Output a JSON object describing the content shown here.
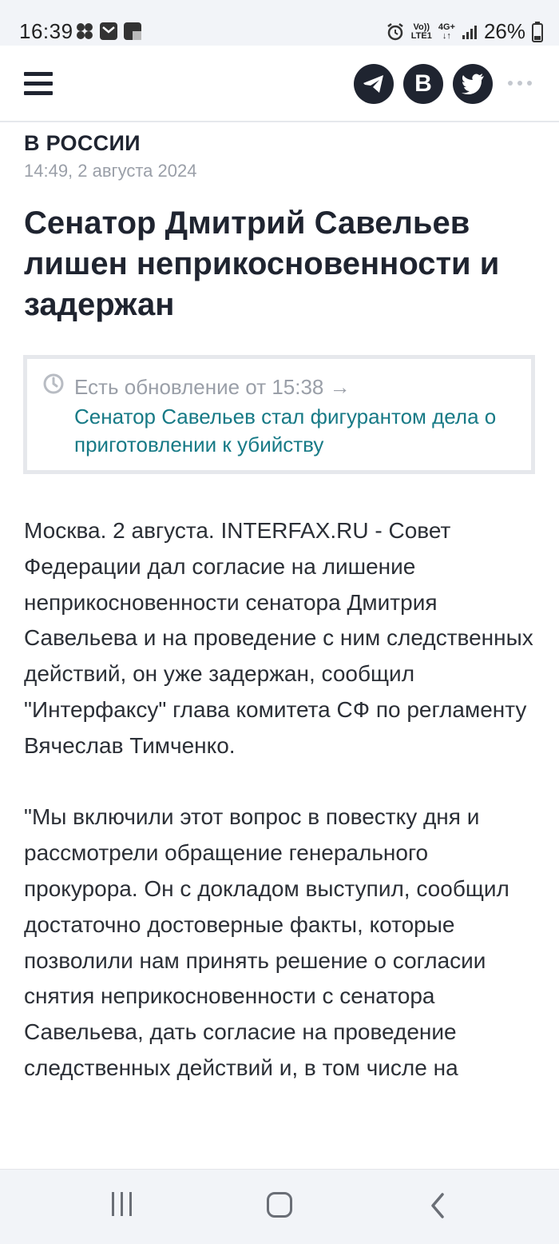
{
  "status_bar": {
    "time": "16:39",
    "volte": "Vo))",
    "lte": "LTE1",
    "network": "4G+",
    "battery": "26%"
  },
  "header": {
    "social_vk_label": "B"
  },
  "article": {
    "rubric": "В РОССИИ",
    "date": "14:49, 2 августа 2024",
    "title": "Сенатор Дмитрий Савельев лишен неприкосновенности и задержан",
    "update": {
      "label": "Есть обновление от 15:38 →",
      "link": "Сенатор Савельев стал фигурантом дела о приготовлении к убийству"
    },
    "paragraphs": [
      "Москва. 2 августа. INTERFAX.RU - Совет Федерации дал согласие на лишение неприкосновенности сенатора Дмитрия Савельева и на проведение с ним следственных действий, он уже задержан, сообщил \"Интерфаксу\" глава комитета СФ по регламенту Вячеслав Тимченко.",
      "\"Мы включили этот вопрос в повестку дня и рассмотрели обращение генерального прокурора. Он с докладом выступил, сообщил достаточно достоверные факты, которые позволили нам принять решение о согласии снятия неприкосновенности с сенатора Савельева, дать согласие на проведение следственных действий и, в том числе на"
    ]
  },
  "colors": {
    "text": "#1f2430",
    "muted": "#9a9fa8",
    "link": "#177a86",
    "border": "#e6e8ec"
  }
}
